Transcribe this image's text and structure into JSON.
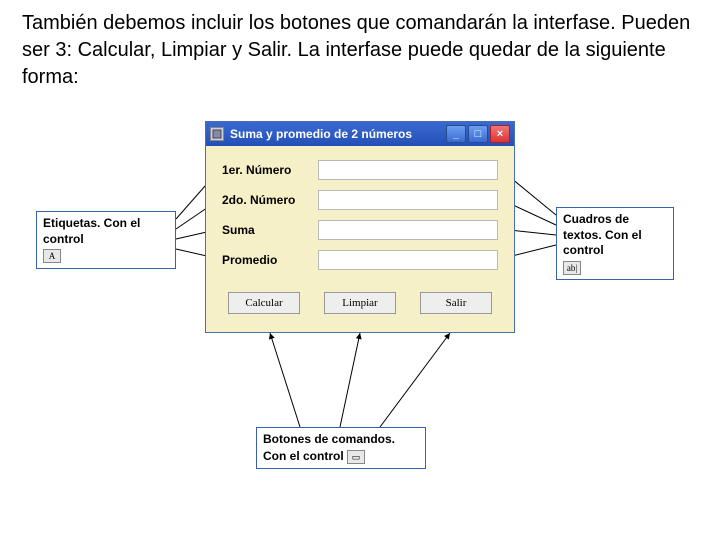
{
  "intro_text": "También debemos incluir los botones que comandarán la interfase. Pueden ser 3: Calcular, Limpiar y Salir. La interfase puede quedar de la siguiente forma:",
  "window": {
    "title": "Suma y promedio de 2 números",
    "labels": {
      "n1": "1er. Número",
      "n2": "2do. Número",
      "suma": "Suma",
      "prom": "Promedio"
    },
    "buttons": {
      "calc": "Calcular",
      "clear": "Limpiar",
      "exit": "Salir"
    }
  },
  "annotations": {
    "labels": "Etiquetas. Con el control",
    "textboxes": "Cuadros de textos. Con el control",
    "buttons": "Botones de comandos. Con el control",
    "tool_label": "A",
    "tool_textbox": "ab|"
  }
}
